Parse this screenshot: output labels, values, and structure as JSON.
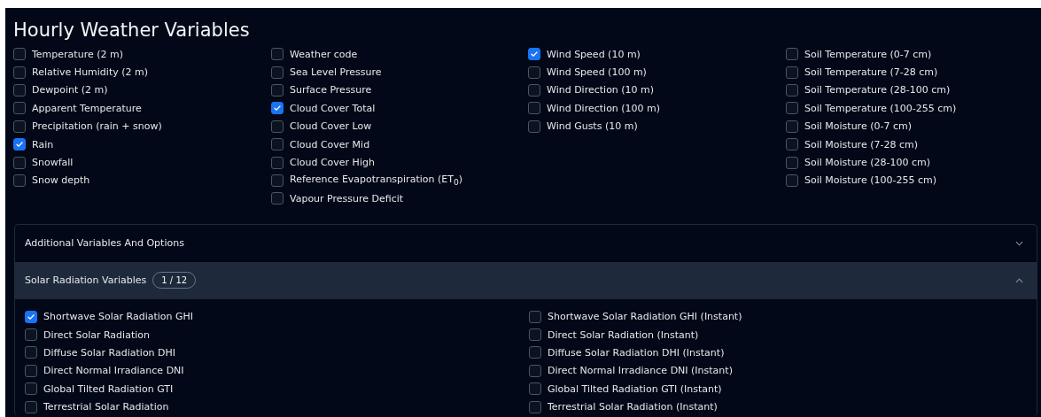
{
  "title": "Hourly Weather Variables",
  "columns": [
    [
      {
        "label": "Temperature (2 m)",
        "checked": false
      },
      {
        "label": "Relative Humidity (2 m)",
        "checked": false
      },
      {
        "label": "Dewpoint (2 m)",
        "checked": false
      },
      {
        "label": "Apparent Temperature",
        "checked": false
      },
      {
        "label": "Precipitation (rain + snow)",
        "checked": false
      },
      {
        "label": "Rain",
        "checked": true
      },
      {
        "label": "Snowfall",
        "checked": false
      },
      {
        "label": "Snow depth",
        "checked": false
      }
    ],
    [
      {
        "label": "Weather code",
        "checked": false
      },
      {
        "label": "Sea Level Pressure",
        "checked": false
      },
      {
        "label": "Surface Pressure",
        "checked": false
      },
      {
        "label": "Cloud Cover Total",
        "checked": true
      },
      {
        "label": "Cloud Cover Low",
        "checked": false
      },
      {
        "label": "Cloud Cover Mid",
        "checked": false
      },
      {
        "label": "Cloud Cover High",
        "checked": false
      },
      {
        "label": "Reference Evapotranspiration (ET$_{0}$)",
        "checked": false
      },
      {
        "label": "Vapour Pressure Deficit",
        "checked": false
      }
    ],
    [
      {
        "label": "Wind Speed (10 m)",
        "checked": true
      },
      {
        "label": "Wind Speed (100 m)",
        "checked": false
      },
      {
        "label": "Wind Direction (10 m)",
        "checked": false
      },
      {
        "label": "Wind Direction (100 m)",
        "checked": false
      },
      {
        "label": "Wind Gusts (10 m)",
        "checked": false
      }
    ],
    [
      {
        "label": "Soil Temperature (0-7 cm)",
        "checked": false
      },
      {
        "label": "Soil Temperature (7-28 cm)",
        "checked": false
      },
      {
        "label": "Soil Temperature (28-100 cm)",
        "checked": false
      },
      {
        "label": "Soil Temperature (100-255 cm)",
        "checked": false
      },
      {
        "label": "Soil Moisture (0-7 cm)",
        "checked": false
      },
      {
        "label": "Soil Moisture (7-28 cm)",
        "checked": false
      },
      {
        "label": "Soil Moisture (28-100 cm)",
        "checked": false
      },
      {
        "label": "Soil Moisture (100-255 cm)",
        "checked": false
      }
    ]
  ],
  "accordion": [
    {
      "title": "Additional Variables And Options",
      "expanded": false
    },
    {
      "title": "Solar Radiation Variables",
      "count": "1 / 12",
      "expanded": true,
      "columns": [
        [
          {
            "label": "Shortwave Solar Radiation GHI",
            "checked": true
          },
          {
            "label": "Direct Solar Radiation",
            "checked": false
          },
          {
            "label": "Diffuse Solar Radiation DHI",
            "checked": false
          },
          {
            "label": "Direct Normal Irradiance DNI",
            "checked": false
          },
          {
            "label": "Global Tilted Radiation GTI",
            "checked": false
          },
          {
            "label": "Terrestrial Solar Radiation",
            "checked": false
          }
        ],
        [
          {
            "label": "Shortwave Solar Radiation GHI (Instant)",
            "checked": false
          },
          {
            "label": "Direct Solar Radiation (Instant)",
            "checked": false
          },
          {
            "label": "Diffuse Solar Radiation DHI (Instant)",
            "checked": false
          },
          {
            "label": "Direct Normal Irradiance DNI (Instant)",
            "checked": false
          },
          {
            "label": "Global Tilted Radiation GTI (Instant)",
            "checked": false
          },
          {
            "label": "Terrestrial Solar Radiation (Instant)",
            "checked": false
          }
        ]
      ]
    }
  ]
}
